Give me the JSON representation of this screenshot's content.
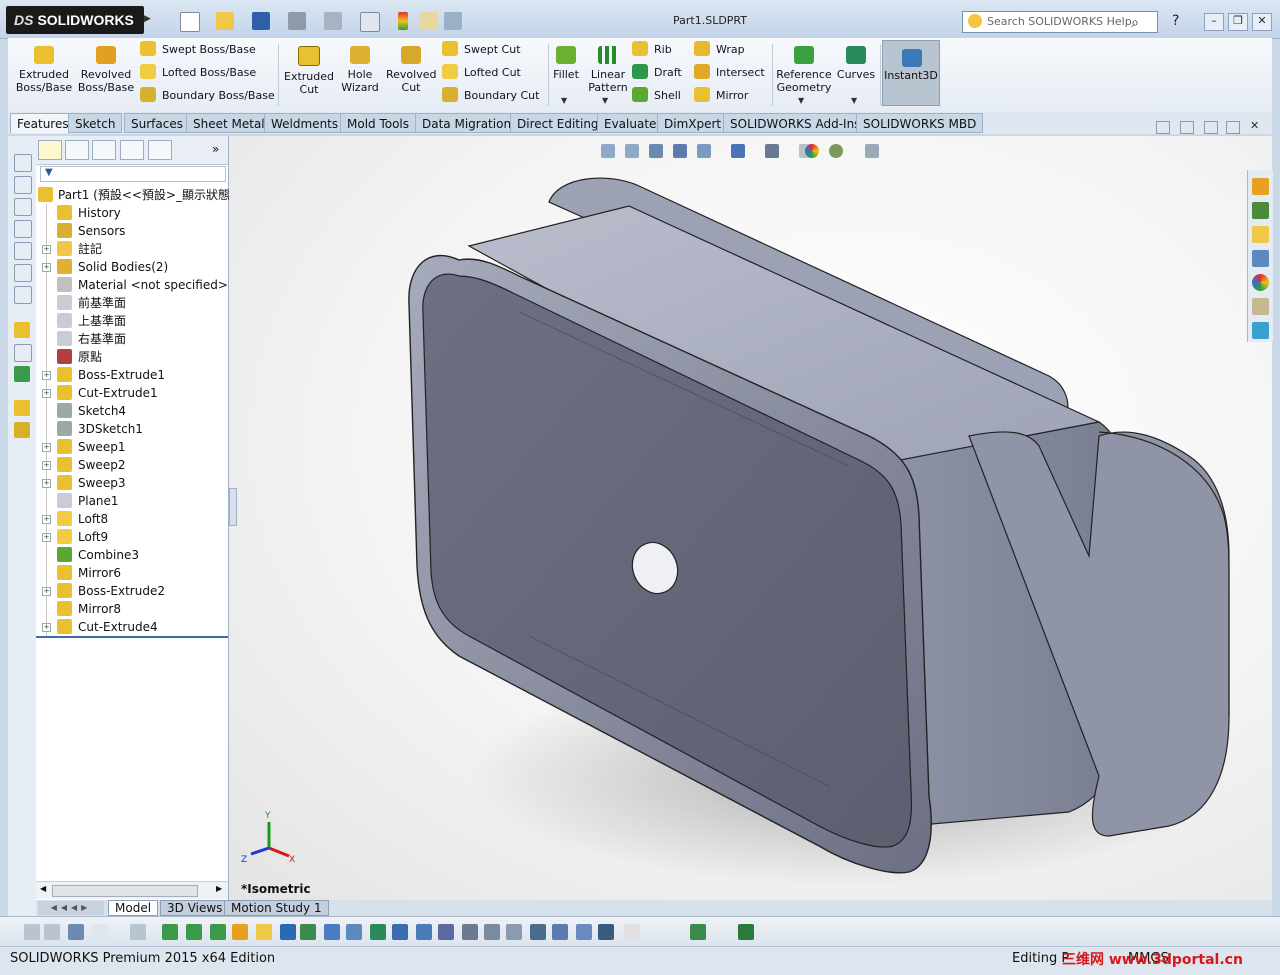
{
  "app": {
    "logo_text": "SOLIDWORKS",
    "logo_mark": "DS",
    "document_title": "Part1.SLDPRT",
    "search_placeholder": "Search SOLIDWORKS Help"
  },
  "commands": {
    "extruded_boss": "Extruded\nBoss/Base",
    "revolved_boss": "Revolved\nBoss/Base",
    "swept_boss": "Swept Boss/Base",
    "lofted_boss": "Lofted Boss/Base",
    "boundary_boss": "Boundary Boss/Base",
    "extruded_cut": "Extruded\nCut",
    "hole_wizard": "Hole\nWizard",
    "revolved_cut": "Revolved\nCut",
    "swept_cut": "Swept Cut",
    "lofted_cut": "Lofted Cut",
    "boundary_cut": "Boundary Cut",
    "fillet": "Fillet",
    "linear_pattern": "Linear\nPattern",
    "rib": "Rib",
    "draft": "Draft",
    "shell": "Shell",
    "wrap": "Wrap",
    "intersect": "Intersect",
    "mirror": "Mirror",
    "reference_geometry": "Reference\nGeometry",
    "curves": "Curves",
    "instant3d": "Instant3D"
  },
  "tabs": [
    "Features",
    "Sketch",
    "Surfaces",
    "Sheet Metal",
    "Weldments",
    "Mold Tools",
    "Data Migration",
    "Direct Editing",
    "Evaluate",
    "DimXpert",
    "SOLIDWORKS Add-Ins",
    "SOLIDWORKS MBD"
  ],
  "tree": {
    "root": "Part1  (預設<<預設>_顯示狀態",
    "items": [
      {
        "label": "History",
        "expand": false
      },
      {
        "label": "Sensors",
        "expand": false
      },
      {
        "label": "註記",
        "expand": true
      },
      {
        "label": "Solid Bodies(2)",
        "expand": true
      },
      {
        "label": "Material <not specified>",
        "expand": false
      },
      {
        "label": "前基準面",
        "expand": false
      },
      {
        "label": "上基準面",
        "expand": false
      },
      {
        "label": "右基準面",
        "expand": false
      },
      {
        "label": "原點",
        "expand": false
      },
      {
        "label": "Boss-Extrude1",
        "expand": true
      },
      {
        "label": "Cut-Extrude1",
        "expand": true
      },
      {
        "label": "Sketch4",
        "expand": false
      },
      {
        "label": "3DSketch1",
        "expand": false
      },
      {
        "label": "Sweep1",
        "expand": true
      },
      {
        "label": "Sweep2",
        "expand": true
      },
      {
        "label": "Sweep3",
        "expand": true
      },
      {
        "label": "Plane1",
        "expand": false
      },
      {
        "label": "Loft8",
        "expand": true
      },
      {
        "label": "Loft9",
        "expand": true
      },
      {
        "label": "Combine3",
        "expand": false
      },
      {
        "label": "Mirror6",
        "expand": false
      },
      {
        "label": "Boss-Extrude2",
        "expand": true
      },
      {
        "label": "Mirror8",
        "expand": false
      },
      {
        "label": "Cut-Extrude4",
        "expand": true
      }
    ]
  },
  "bottom_tabs": [
    "Model",
    "3D Views",
    "Motion Study 1"
  ],
  "view": {
    "name": "*Isometric",
    "axis_x": "X",
    "axis_y": "Y",
    "axis_z": "Z"
  },
  "status": {
    "product": "SOLIDWORKS Premium 2015 x64 Edition",
    "editing": "Editing P",
    "units": "MMGS",
    "watermark": "三维网 www.3dportal.cn"
  },
  "colors": {
    "accent_blue": "#3a6ea5",
    "part_gray": "#8a8fa3",
    "feature_yellow": "#f0c020"
  }
}
